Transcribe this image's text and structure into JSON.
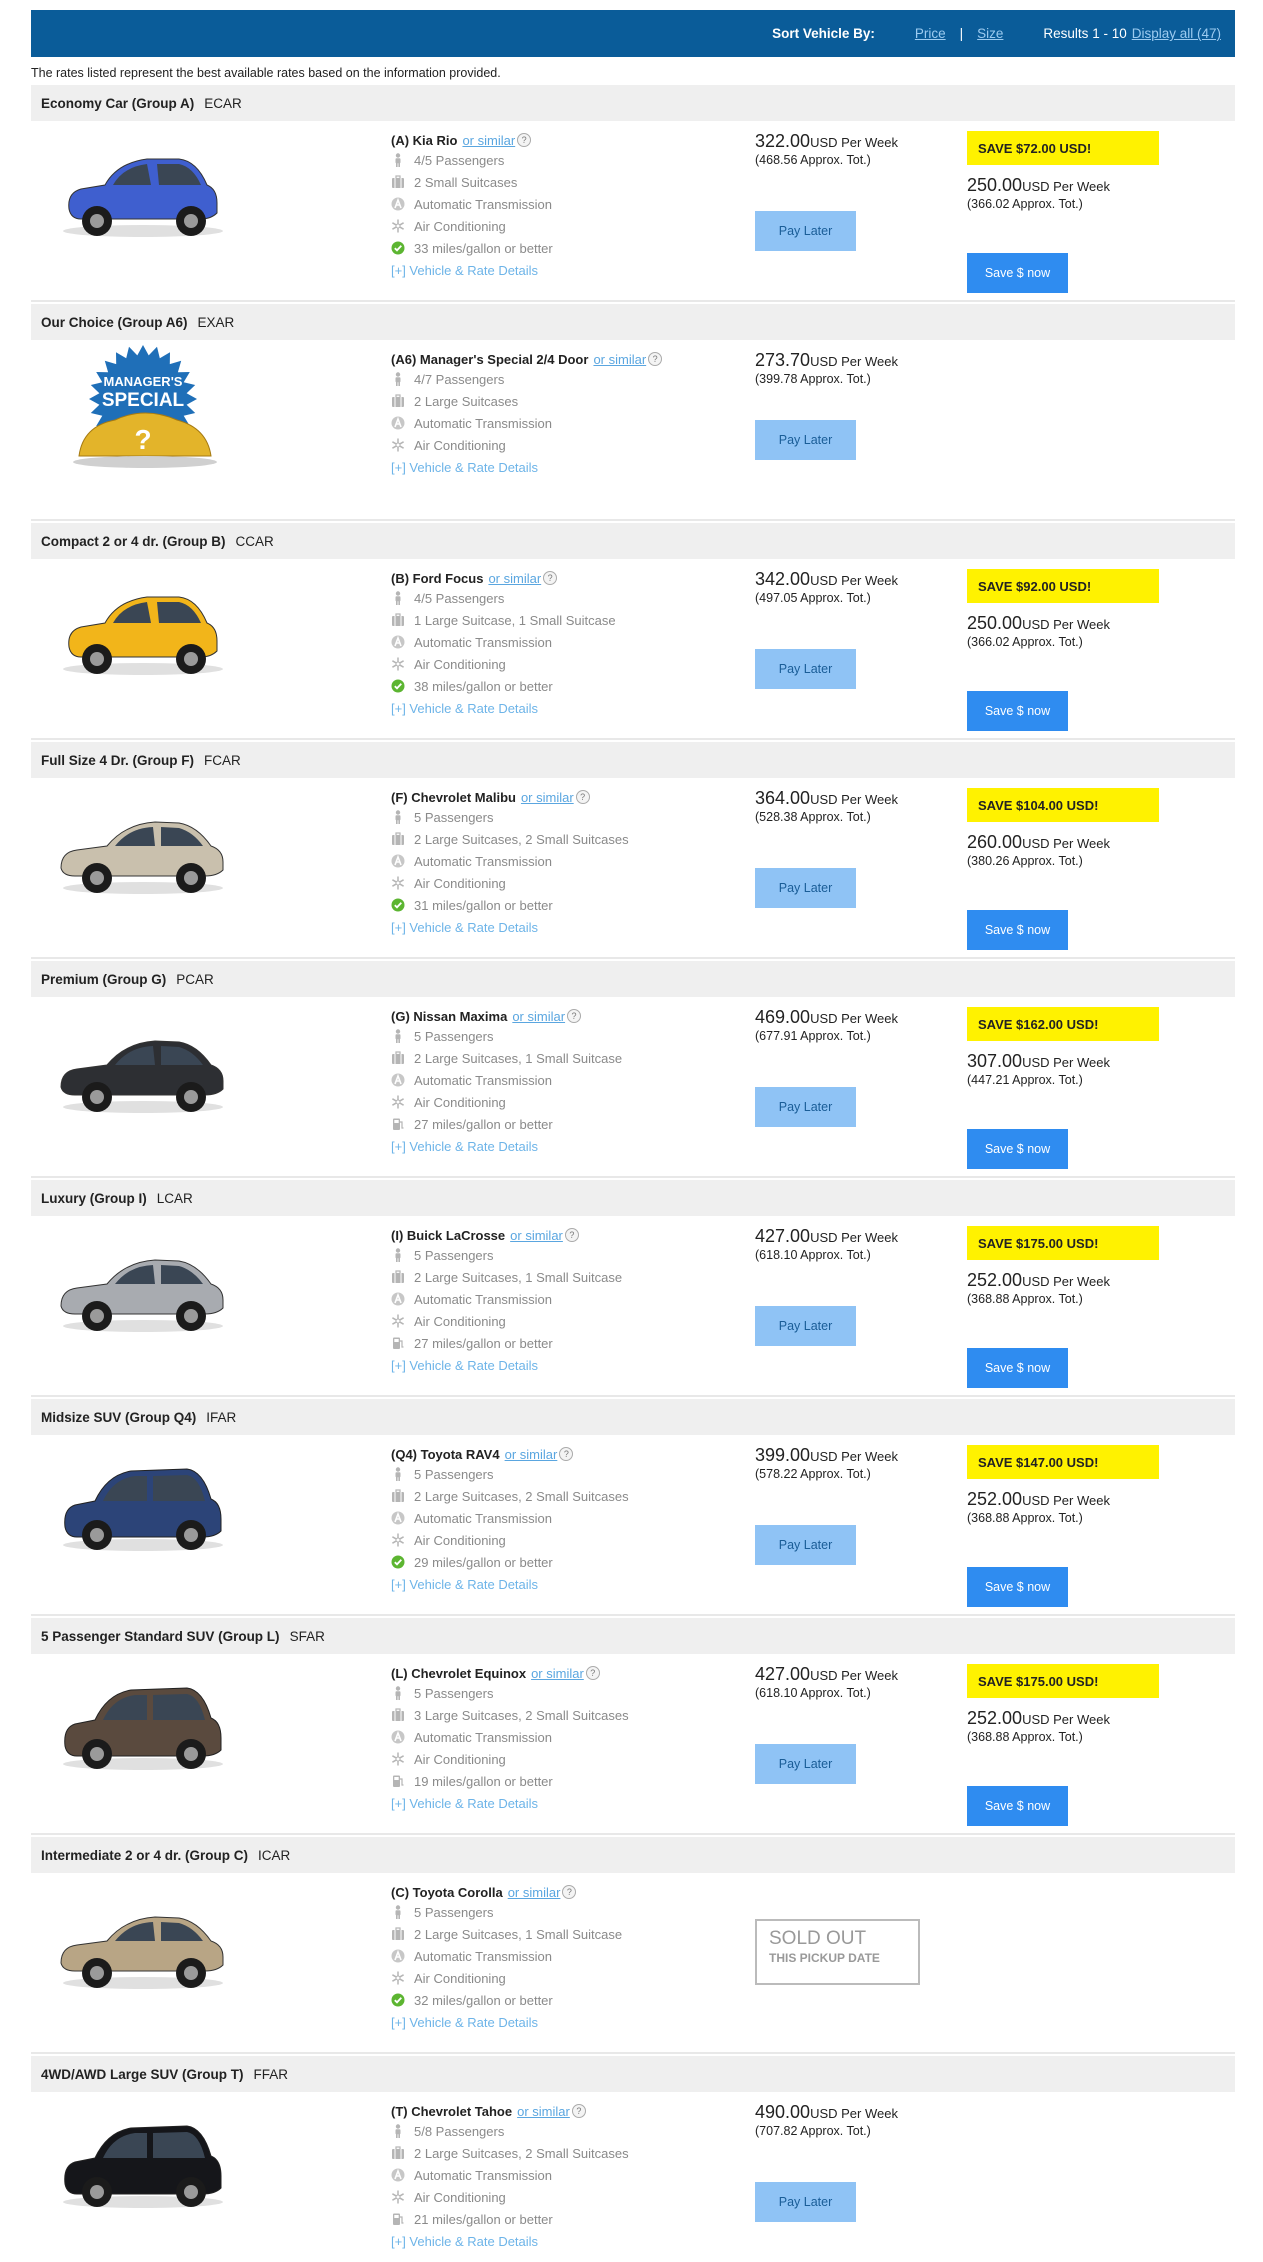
{
  "sortbar": {
    "label": "Sort Vehicle By:",
    "price": "Price",
    "separator": "|",
    "size": "Size",
    "results": "Results 1 - 10",
    "display_all": "Display all (47)"
  },
  "disclaimer": "The rates listed represent the best available rates based on the information provided.",
  "common": {
    "or_similar": "or similar",
    "help": "?",
    "details": "[+] Vehicle & Rate Details",
    "unit": "USD Per Week",
    "pay_later": "Pay Later",
    "save_now": "Save $ now",
    "sold_out": "SOLD OUT",
    "sold_out_sub": "THIS PICKUP DATE"
  },
  "special_badge": {
    "line1": "MANAGER'S",
    "line2": "SPECIAL",
    "mark": "?"
  },
  "colors": {
    "header": "#0a5c99",
    "pay_later": "#8fc3f5",
    "save_now": "#2f8cf0",
    "save_badge": "#fff200"
  },
  "groups": [
    {
      "name": "Economy Car (Group A)",
      "code": "ECAR",
      "vehicle": "(A) Kia Rio",
      "car_color": "#3f5fcf",
      "car_type": "hatch",
      "features": [
        {
          "icon": "passenger-icon",
          "text": "4/5 Passengers"
        },
        {
          "icon": "suitcase-icon",
          "text": "2 Small Suitcases"
        },
        {
          "icon": "automatic-icon",
          "text": "Automatic Transmission"
        },
        {
          "icon": "snowflake-icon",
          "text": "Air Conditioning"
        },
        {
          "icon": "checkmark-icon",
          "text": "33 miles/gallon or better"
        }
      ],
      "rate": "322.00",
      "approx": "(468.56 Approx. Tot.)",
      "save_badge": "SAVE $72.00 USD!",
      "save_rate": "250.00",
      "save_approx": "(366.02 Approx. Tot.)"
    },
    {
      "name": "Our Choice (Group A6)",
      "code": "EXAR",
      "vehicle": "(A6) Manager's Special 2/4 Door",
      "car_color": "",
      "car_type": "special",
      "features": [
        {
          "icon": "passenger-icon",
          "text": "4/7 Passengers"
        },
        {
          "icon": "suitcase-icon",
          "text": "2 Large Suitcases"
        },
        {
          "icon": "automatic-icon",
          "text": "Automatic Transmission"
        },
        {
          "icon": "snowflake-icon",
          "text": "Air Conditioning"
        }
      ],
      "rate": "273.70",
      "approx": "(399.78 Approx. Tot.)"
    },
    {
      "name": "Compact 2 or 4 dr. (Group B)",
      "code": "CCAR",
      "vehicle": "(B) Ford Focus",
      "car_color": "#f2b51a",
      "car_type": "hatch",
      "features": [
        {
          "icon": "passenger-icon",
          "text": "4/5 Passengers"
        },
        {
          "icon": "suitcase-icon",
          "text": "1 Large Suitcase, 1 Small Suitcase"
        },
        {
          "icon": "automatic-icon",
          "text": "Automatic Transmission"
        },
        {
          "icon": "snowflake-icon",
          "text": "Air Conditioning"
        },
        {
          "icon": "checkmark-icon",
          "text": "38 miles/gallon or better"
        }
      ],
      "rate": "342.00",
      "approx": "(497.05 Approx. Tot.)",
      "save_badge": "SAVE $92.00 USD!",
      "save_rate": "250.00",
      "save_approx": "(366.02 Approx. Tot.)"
    },
    {
      "name": "Full Size 4 Dr. (Group F)",
      "code": "FCAR",
      "vehicle": "(F) Chevrolet Malibu",
      "car_color": "#c9c0ad",
      "car_type": "sedan",
      "features": [
        {
          "icon": "passenger-icon",
          "text": "5 Passengers"
        },
        {
          "icon": "suitcase-icon",
          "text": "2 Large Suitcases, 2 Small Suitcases"
        },
        {
          "icon": "automatic-icon",
          "text": "Automatic Transmission"
        },
        {
          "icon": "snowflake-icon",
          "text": "Air Conditioning"
        },
        {
          "icon": "checkmark-icon",
          "text": "31 miles/gallon or better"
        }
      ],
      "rate": "364.00",
      "approx": "(528.38 Approx. Tot.)",
      "save_badge": "SAVE $104.00 USD!",
      "save_rate": "260.00",
      "save_approx": "(380.26 Approx. Tot.)"
    },
    {
      "name": "Premium (Group G)",
      "code": "PCAR",
      "vehicle": "(G) Nissan Maxima",
      "car_color": "#2d2f33",
      "car_type": "sedan",
      "features": [
        {
          "icon": "passenger-icon",
          "text": "5 Passengers"
        },
        {
          "icon": "suitcase-icon",
          "text": "2 Large Suitcases, 1 Small Suitcase"
        },
        {
          "icon": "automatic-icon",
          "text": "Automatic Transmission"
        },
        {
          "icon": "snowflake-icon",
          "text": "Air Conditioning"
        },
        {
          "icon": "fuel-icon",
          "text": "27 miles/gallon or better"
        }
      ],
      "rate": "469.00",
      "approx": "(677.91 Approx. Tot.)",
      "save_badge": "SAVE $162.00 USD!",
      "save_rate": "307.00",
      "save_approx": "(447.21 Approx. Tot.)"
    },
    {
      "name": "Luxury (Group I)",
      "code": "LCAR",
      "vehicle": "(I) Buick LaCrosse",
      "car_color": "#a8abb0",
      "car_type": "sedan",
      "features": [
        {
          "icon": "passenger-icon",
          "text": "5 Passengers"
        },
        {
          "icon": "suitcase-icon",
          "text": "2 Large Suitcases, 1 Small Suitcase"
        },
        {
          "icon": "automatic-icon",
          "text": "Automatic Transmission"
        },
        {
          "icon": "snowflake-icon",
          "text": "Air Conditioning"
        },
        {
          "icon": "fuel-icon",
          "text": "27 miles/gallon or better"
        }
      ],
      "rate": "427.00",
      "approx": "(618.10 Approx. Tot.)",
      "save_badge": "SAVE $175.00 USD!",
      "save_rate": "252.00",
      "save_approx": "(368.88 Approx. Tot.)"
    },
    {
      "name": "Midsize SUV (Group Q4)",
      "code": "IFAR",
      "vehicle": "(Q4) Toyota RAV4",
      "car_color": "#2c4478",
      "car_type": "suv",
      "features": [
        {
          "icon": "passenger-icon",
          "text": "5 Passengers"
        },
        {
          "icon": "suitcase-icon",
          "text": "2 Large Suitcases, 2 Small Suitcases"
        },
        {
          "icon": "automatic-icon",
          "text": "Automatic Transmission"
        },
        {
          "icon": "snowflake-icon",
          "text": "Air Conditioning"
        },
        {
          "icon": "checkmark-icon",
          "text": "29 miles/gallon or better"
        }
      ],
      "rate": "399.00",
      "approx": "(578.22 Approx. Tot.)",
      "save_badge": "SAVE $147.00 USD!",
      "save_rate": "252.00",
      "save_approx": "(368.88 Approx. Tot.)"
    },
    {
      "name": "5 Passenger Standard SUV (Group L)",
      "code": "SFAR",
      "vehicle": "(L) Chevrolet Equinox",
      "car_color": "#5a4a3e",
      "car_type": "suv",
      "features": [
        {
          "icon": "passenger-icon",
          "text": "5 Passengers"
        },
        {
          "icon": "suitcase-icon",
          "text": "3 Large Suitcases, 2 Small Suitcases"
        },
        {
          "icon": "automatic-icon",
          "text": "Automatic Transmission"
        },
        {
          "icon": "snowflake-icon",
          "text": "Air Conditioning"
        },
        {
          "icon": "fuel-icon",
          "text": "19 miles/gallon or better"
        }
      ],
      "rate": "427.00",
      "approx": "(618.10 Approx. Tot.)",
      "save_badge": "SAVE $175.00 USD!",
      "save_rate": "252.00",
      "save_approx": "(368.88 Approx. Tot.)"
    },
    {
      "name": "Intermediate 2 or 4 dr. (Group C)",
      "code": "ICAR",
      "vehicle": "(C) Toyota Corolla",
      "car_color": "#b8a585",
      "car_type": "sedan",
      "features": [
        {
          "icon": "passenger-icon",
          "text": "5 Passengers"
        },
        {
          "icon": "suitcase-icon",
          "text": "2 Large Suitcases, 1 Small Suitcase"
        },
        {
          "icon": "automatic-icon",
          "text": "Automatic Transmission"
        },
        {
          "icon": "snowflake-icon",
          "text": "Air Conditioning"
        },
        {
          "icon": "checkmark-icon",
          "text": "32 miles/gallon or better"
        }
      ],
      "sold_out": true
    },
    {
      "name": "4WD/AWD Large SUV (Group T)",
      "code": "FFAR",
      "vehicle": "(T) Chevrolet Tahoe",
      "car_color": "#15161a",
      "car_type": "suv",
      "features": [
        {
          "icon": "passenger-icon",
          "text": "5/8 Passengers"
        },
        {
          "icon": "suitcase-icon",
          "text": "2 Large Suitcases, 2 Small Suitcases"
        },
        {
          "icon": "automatic-icon",
          "text": "Automatic Transmission"
        },
        {
          "icon": "snowflake-icon",
          "text": "Air Conditioning"
        },
        {
          "icon": "fuel-icon",
          "text": "21 miles/gallon or better"
        }
      ],
      "rate": "490.00",
      "approx": "(707.82 Approx. Tot.)"
    }
  ]
}
